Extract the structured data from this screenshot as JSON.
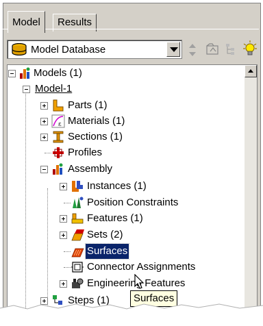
{
  "tabs": [
    {
      "label": "Model",
      "active": true
    },
    {
      "label": "Results",
      "active": false
    }
  ],
  "toolbar": {
    "database_label": "Model Database",
    "icons": [
      "database-icon",
      "up-down-arrows-icon",
      "filter-icon",
      "tree-icon",
      "lightbulb-icon"
    ]
  },
  "tree": {
    "root": {
      "label": "Models (1)",
      "icon": "models-icon"
    },
    "model": {
      "label": "Model-1"
    },
    "items": [
      {
        "label": "Parts (1)",
        "icon": "parts-icon",
        "expander": "plus"
      },
      {
        "label": "Materials (1)",
        "icon": "materials-icon",
        "expander": "plus"
      },
      {
        "label": "Sections (1)",
        "icon": "sections-icon",
        "expander": "plus"
      },
      {
        "label": "Profiles",
        "icon": "profiles-icon",
        "expander": "none"
      },
      {
        "label": "Assembly",
        "icon": "assembly-icon",
        "expander": "minus"
      }
    ],
    "assembly_items": [
      {
        "label": "Instances (1)",
        "icon": "instances-icon",
        "expander": "plus"
      },
      {
        "label": "Position Constraints",
        "icon": "position-constraints-icon",
        "expander": "none"
      },
      {
        "label": "Features (1)",
        "icon": "features-icon",
        "expander": "plus"
      },
      {
        "label": "Sets (2)",
        "icon": "sets-icon",
        "expander": "plus"
      },
      {
        "label": "Surfaces",
        "icon": "surfaces-icon",
        "expander": "none",
        "selected": true
      },
      {
        "label": "Connector Assignments",
        "icon": "connector-icon",
        "expander": "none"
      },
      {
        "label": "Engineering Features",
        "icon": "engineering-icon",
        "expander": "plus"
      }
    ],
    "partial": {
      "label": "Steps (1)",
      "icon": "steps-icon"
    }
  },
  "tooltip": {
    "text": "Surfaces"
  },
  "colors": {
    "selection": "#0a246a",
    "tooltip_bg": "#ffffe1",
    "panel": "#d4d0c8"
  }
}
